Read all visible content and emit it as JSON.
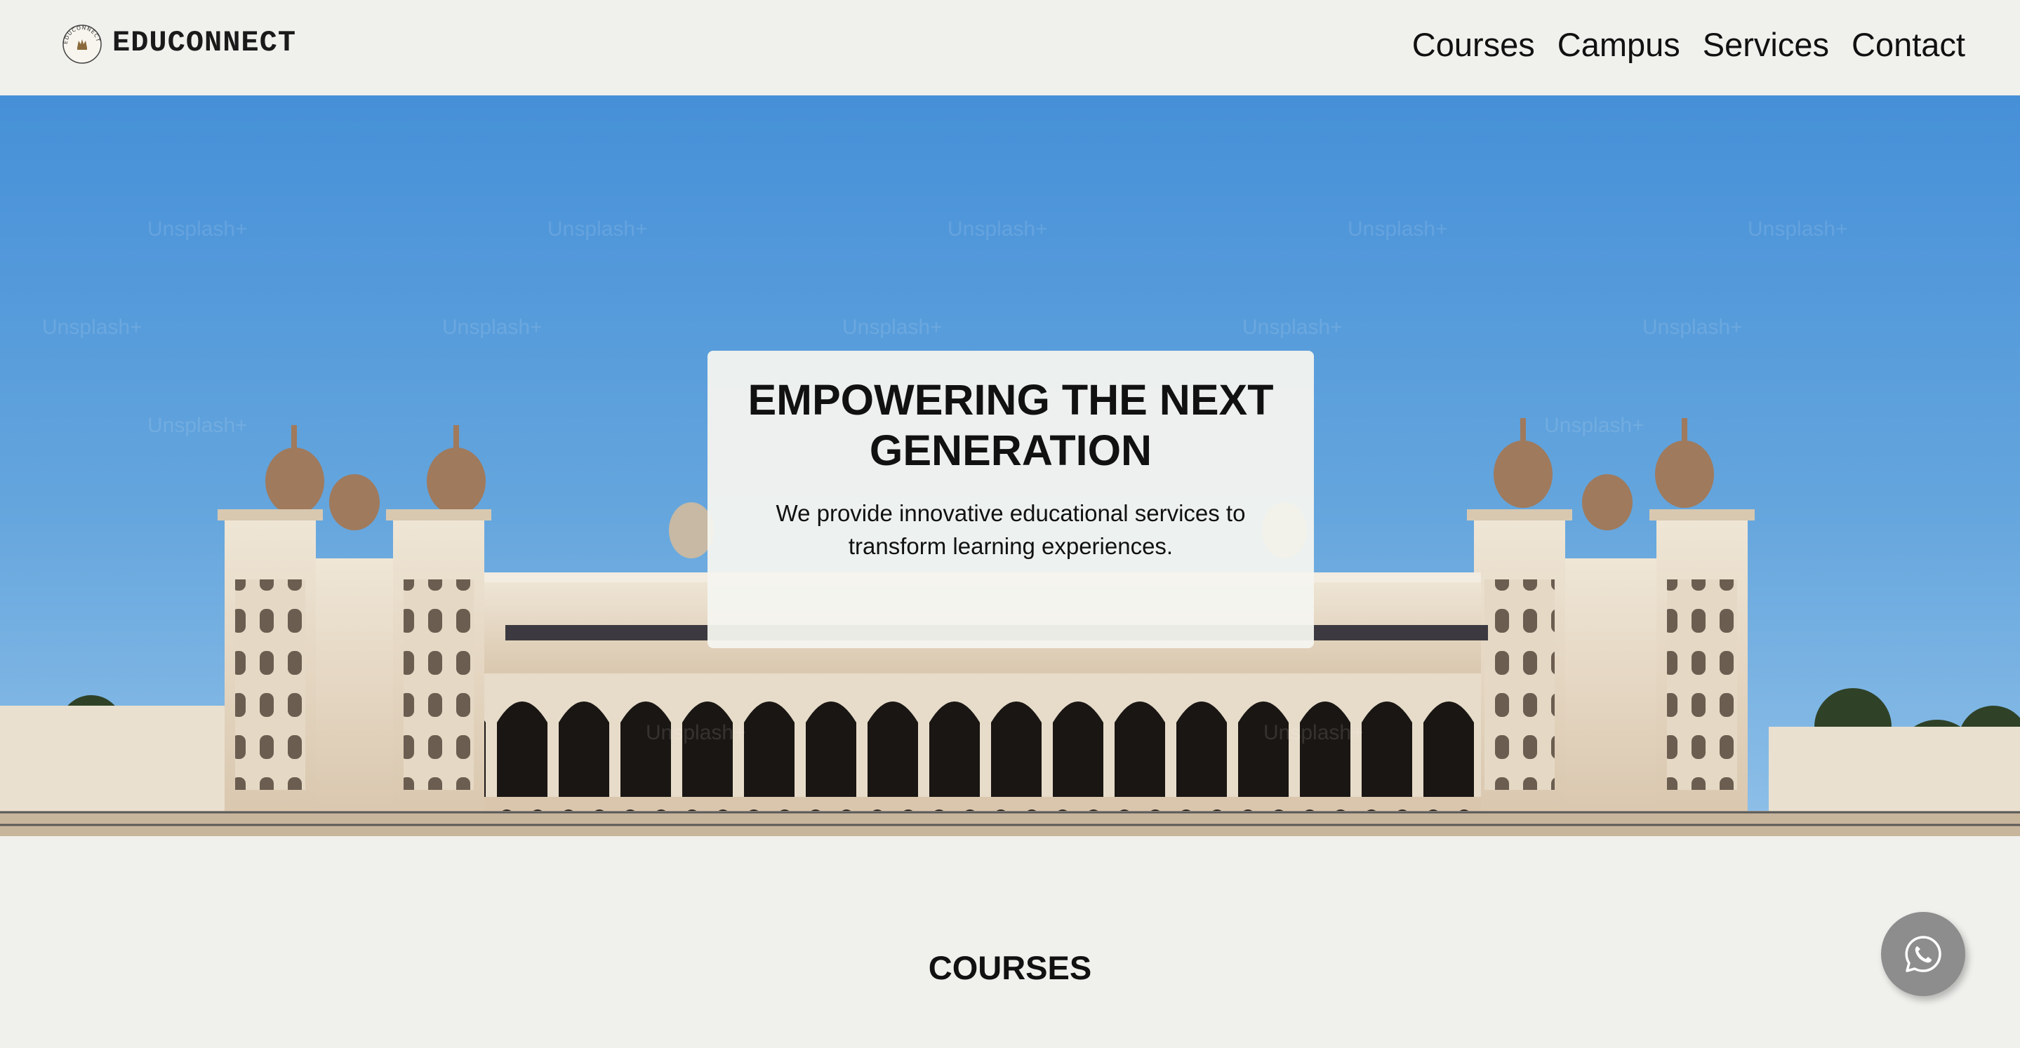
{
  "header": {
    "logo_text": "EDUCONNECT",
    "logo_ring_text": "EDUCONNECT",
    "nav": [
      "Courses",
      "Campus",
      "Services",
      "Contact"
    ]
  },
  "hero": {
    "title": "EMPOWERING THE NEXT GENERATION",
    "subtitle": "We provide innovative educational services to transform learning experiences.",
    "watermark": "Unsplash+"
  },
  "courses": {
    "heading": "COURSES"
  },
  "floating": {
    "icon": "whatsapp-icon"
  },
  "colors": {
    "page_bg": "#f0f1ed",
    "sky": "#4a94d6",
    "palace": "#e8ddcc",
    "dome": "#a07a5c",
    "fab": "#8d8d8d"
  }
}
